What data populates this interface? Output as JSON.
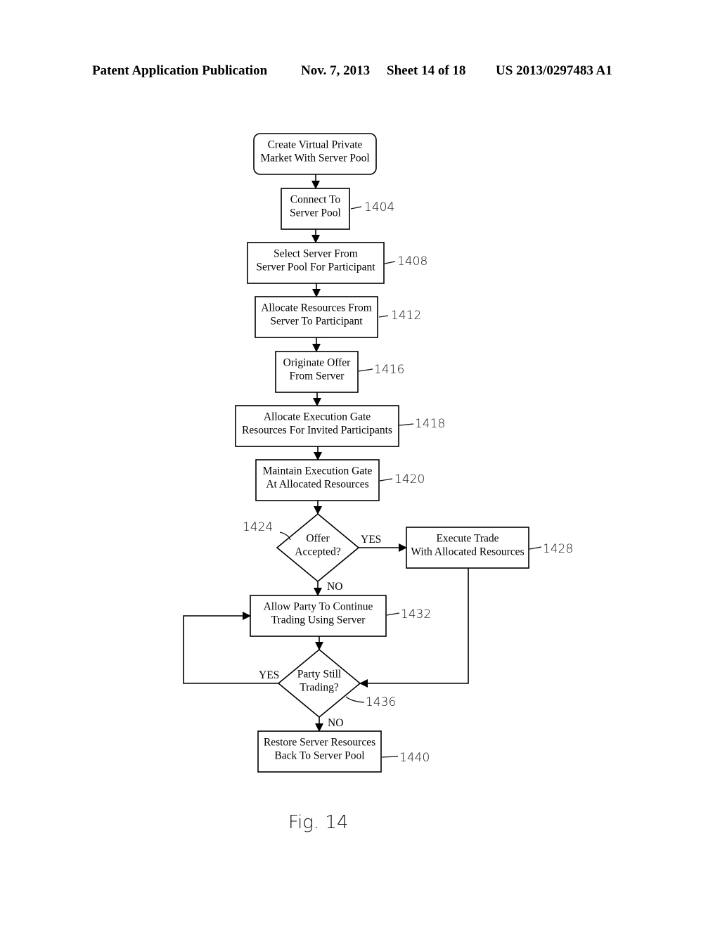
{
  "header": {
    "publication": "Patent Application Publication",
    "date": "Nov. 7, 2013",
    "sheet": "Sheet 14 of 18",
    "number": "US 2013/0297483 A1"
  },
  "flowchart": {
    "nodes": [
      {
        "id": "start",
        "type": "terminal",
        "lines": [
          "Create Virtual Private",
          "Market With Server Pool"
        ],
        "ref": ""
      },
      {
        "id": "n1404",
        "type": "process",
        "lines": [
          "Connect To",
          "Server Pool"
        ],
        "ref": "1404"
      },
      {
        "id": "n1408",
        "type": "process",
        "lines": [
          "Select Server From",
          "Server Pool For Participant"
        ],
        "ref": "1408"
      },
      {
        "id": "n1412",
        "type": "process",
        "lines": [
          "Allocate Resources From",
          "Server To Participant"
        ],
        "ref": "1412"
      },
      {
        "id": "n1416",
        "type": "process",
        "lines": [
          "Originate Offer",
          "From Server"
        ],
        "ref": "1416"
      },
      {
        "id": "n1418",
        "type": "process",
        "lines": [
          "Allocate Execution Gate",
          "Resources For Invited Participants"
        ],
        "ref": "1418"
      },
      {
        "id": "n1420",
        "type": "process",
        "lines": [
          "Maintain Execution Gate",
          "At Allocated Resources"
        ],
        "ref": "1420"
      },
      {
        "id": "n1424",
        "type": "decision",
        "lines": [
          "Offer",
          "Accepted?"
        ],
        "ref": "1424"
      },
      {
        "id": "n1428",
        "type": "process",
        "lines": [
          "Execute Trade",
          "With Allocated Resources"
        ],
        "ref": "1428"
      },
      {
        "id": "n1432",
        "type": "process",
        "lines": [
          "Allow Party To Continue",
          "Trading Using Server"
        ],
        "ref": "1432"
      },
      {
        "id": "n1436",
        "type": "decision",
        "lines": [
          "Party Still",
          "Trading?"
        ],
        "ref": "1436"
      },
      {
        "id": "n1440",
        "type": "process",
        "lines": [
          "Restore Server Resources",
          "Back To Server Pool"
        ],
        "ref": "1440"
      }
    ],
    "edges": [
      {
        "from": "start",
        "to": "n1404",
        "label": ""
      },
      {
        "from": "n1404",
        "to": "n1408",
        "label": ""
      },
      {
        "from": "n1408",
        "to": "n1412",
        "label": ""
      },
      {
        "from": "n1412",
        "to": "n1416",
        "label": ""
      },
      {
        "from": "n1416",
        "to": "n1418",
        "label": ""
      },
      {
        "from": "n1418",
        "to": "n1420",
        "label": ""
      },
      {
        "from": "n1420",
        "to": "n1424",
        "label": ""
      },
      {
        "from": "n1424",
        "to": "n1428",
        "label": "YES"
      },
      {
        "from": "n1424",
        "to": "n1432",
        "label": "NO"
      },
      {
        "from": "n1428",
        "to": "n1436",
        "label": ""
      },
      {
        "from": "n1432",
        "to": "n1436",
        "label": ""
      },
      {
        "from": "n1436",
        "to": "n1432",
        "label": "YES"
      },
      {
        "from": "n1436",
        "to": "n1440",
        "label": "NO"
      }
    ]
  },
  "figure_label": "Fig. 14"
}
